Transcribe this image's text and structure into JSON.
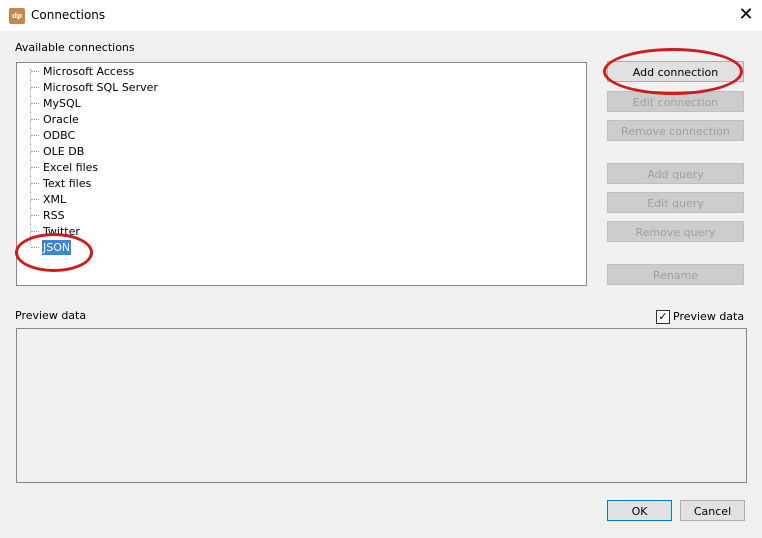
{
  "window": {
    "title": "Connections",
    "app_icon_text": "dp",
    "close_glyph": "✕"
  },
  "connections": {
    "label": "Available connections",
    "items": [
      {
        "label": "Microsoft Access"
      },
      {
        "label": "Microsoft SQL Server"
      },
      {
        "label": "MySQL"
      },
      {
        "label": "Oracle"
      },
      {
        "label": "ODBC"
      },
      {
        "label": "OLE DB"
      },
      {
        "label": "Excel files"
      },
      {
        "label": "Text files"
      },
      {
        "label": "XML"
      },
      {
        "label": "RSS"
      },
      {
        "label": "Twitter"
      },
      {
        "label": "JSON",
        "selected": true
      }
    ]
  },
  "buttons": {
    "add_connection": "Add connection",
    "edit_connection": "Edit connection",
    "remove_connection": "Remove connection",
    "add_query": "Add query",
    "edit_query": "Edit query",
    "remove_query": "Remove query",
    "rename": "Rename",
    "ok": "OK",
    "cancel": "Cancel"
  },
  "preview": {
    "label": "Preview data",
    "checkbox_label": "Preview data",
    "checked": true,
    "check_glyph": "✓"
  },
  "colors": {
    "highlight_oval": "#d11a1a",
    "selection": "#3c86d6"
  }
}
